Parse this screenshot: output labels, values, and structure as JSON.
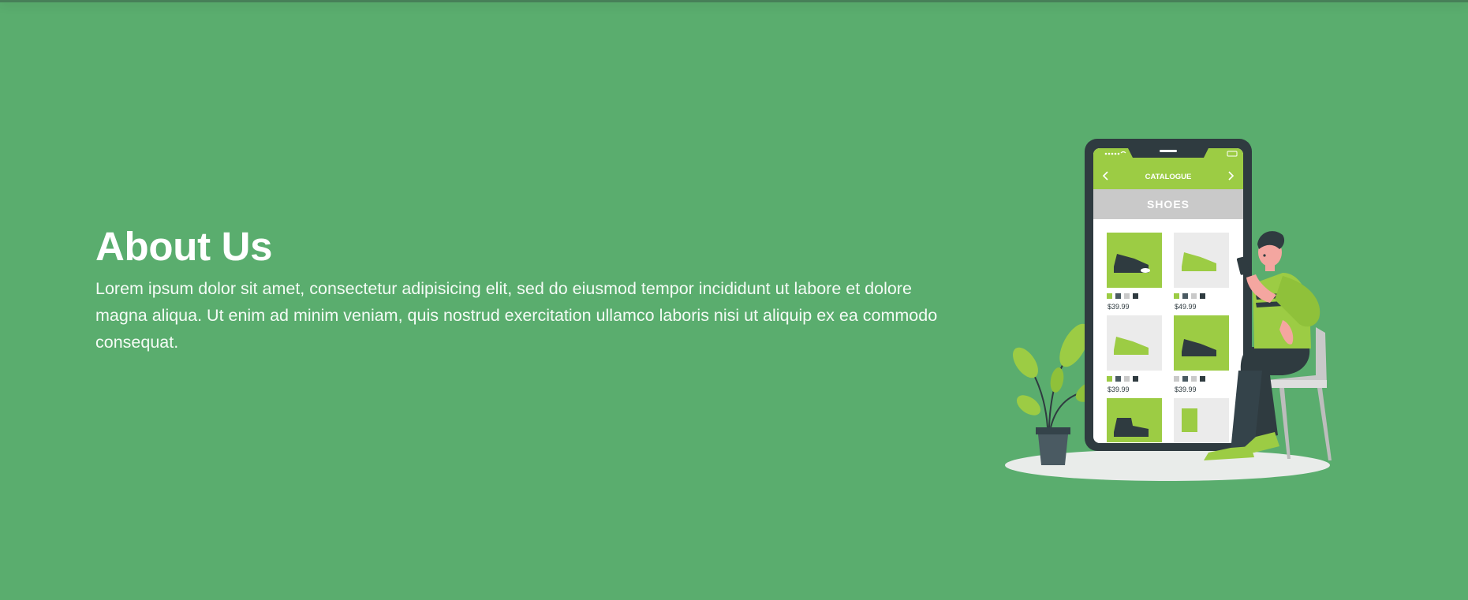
{
  "about": {
    "title": "About Us",
    "body": "Lorem ipsum dolor sit amet, consectetur adipisicing elit, sed do eiusmod tempor incididunt ut labore et dolore magna aliqua. Ut enim ad minim veniam, quis nostrud exercitation ullamco laboris nisi ut aliquip ex ea commodo consequat."
  },
  "illustration": {
    "app_title": "CATALOGUE",
    "category": "SHOES",
    "prices": [
      "$39.99",
      "$49.99",
      "$39.99",
      "$39.99"
    ]
  },
  "colors": {
    "background": "#5aad6e",
    "accent_green": "#9ccc44",
    "phone_dark": "#2f3b40"
  },
  "icons": [
    "chevron-left-icon",
    "chevron-right-icon",
    "signal-icon",
    "wifi-icon",
    "battery-icon"
  ]
}
